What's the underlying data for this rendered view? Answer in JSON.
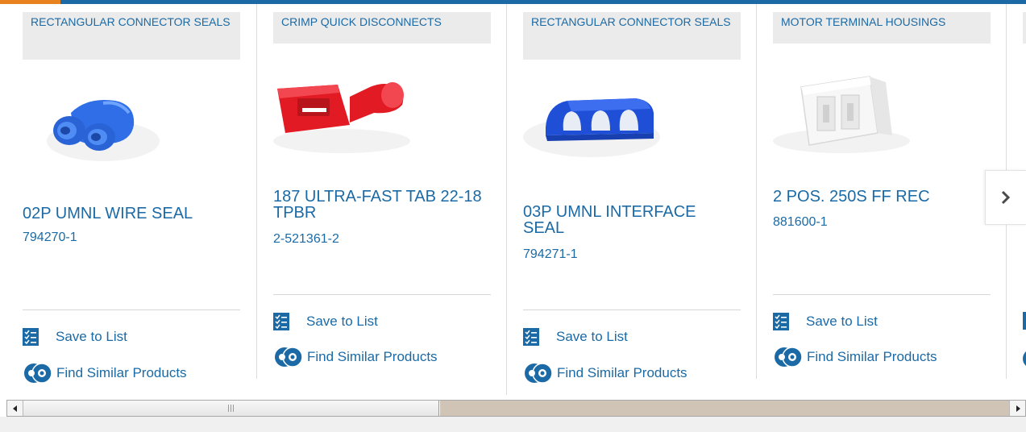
{
  "colors": {
    "brand": "#1b6aa5",
    "accent": "#e8821e",
    "category_bg": "#ebebeb"
  },
  "cards": [
    {
      "category": "RECTANGULAR CONNECTOR SEALS",
      "image": "blue-double-wire-seal",
      "name": "02P UMNL WIRE SEAL",
      "part_number": "794270-1",
      "save_label": "Save to List",
      "find_label": "Find Similar Products"
    },
    {
      "category": "CRIMP QUICK DISCONNECTS",
      "image": "red-quick-disconnect",
      "name": "187 ULTRA-FAST TAB 22-18 TPBR",
      "part_number": "2-521361-2",
      "save_label": "Save to List",
      "find_label": "Find Similar Products"
    },
    {
      "category": "RECTANGULAR CONNECTOR SEALS",
      "image": "blue-interface-seal",
      "name": "03P UMNL INTERFACE SEAL",
      "part_number": "794271-1",
      "save_label": "Save to List",
      "find_label": "Find Similar Products"
    },
    {
      "category": "MOTOR TERMINAL HOUSINGS",
      "image": "white-terminal-housing",
      "name": "2 POS. 250S FF REC",
      "part_number": "881600-1",
      "save_label": "Save to List",
      "find_label": "Find Similar Products"
    }
  ],
  "carousel": {
    "next_icon": "chevron-right-icon"
  },
  "scrollbar": {
    "left_icon": "arrow-left-icon",
    "right_icon": "arrow-right-icon"
  }
}
